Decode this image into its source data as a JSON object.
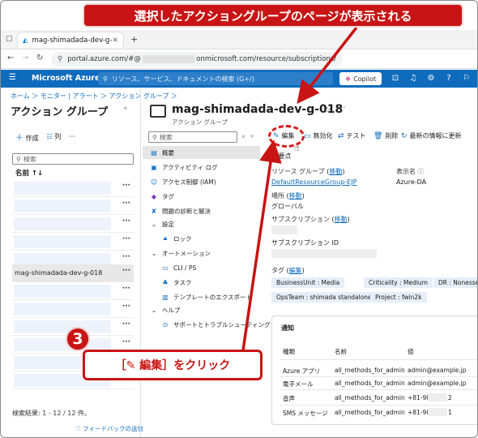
{
  "annotations": {
    "top_callout": "選択したアクショングループのページが表示される",
    "step_number": "3",
    "bottom_callout": "［✎ 編集］をクリック"
  },
  "browser": {
    "tab_title": "mag-shimadada-dev-g-018 - M",
    "url_prefix": "portal.azure.com/#@",
    "url_suffix": "onmicrosoft.com/resource/subscriptions/"
  },
  "portal": {
    "brand": "Microsoft Azure",
    "search_placeholder": "リソース、サービス、ドキュメントの検索 (G+/)",
    "copilot_label": "Copilot"
  },
  "left_pane": {
    "breadcrumb": "ホーム ＞ モニター | アラート ＞ アクション グループ ＞",
    "title": "アクション グループ",
    "create_label": "作成",
    "columns_label": "列",
    "search_placeholder": "検索",
    "name_header": "名前 ↑↓",
    "selected_item": "mag-shimadada-dev-g-018",
    "result_count": "検索結果: 1 - 12 / 12 件。",
    "feedback": "フィードバックの送信"
  },
  "resource": {
    "title": "mag-shimadada-dev-g-018",
    "subtitle": "アクション グループ",
    "menu_search_placeholder": "検索",
    "menu": [
      {
        "label": "概要",
        "icon": "overview-icon"
      },
      {
        "label": "アクティビティ ログ",
        "icon": "activity-log-icon"
      },
      {
        "label": "アクセス制御 (IAM)",
        "icon": "iam-icon"
      },
      {
        "label": "タグ",
        "icon": "tag-icon"
      },
      {
        "label": "問題の診断と解決",
        "icon": "diagnose-icon"
      },
      {
        "label": "設定",
        "icon": "chevron-down-icon"
      },
      {
        "label": "ロック",
        "icon": "lock-icon"
      },
      {
        "label": "オートメーション",
        "icon": "chevron-down-icon"
      },
      {
        "label": "CLI / PS",
        "icon": "cli-icon"
      },
      {
        "label": "タスク",
        "icon": "task-icon"
      },
      {
        "label": "テンプレートのエクスポート",
        "icon": "export-template-icon"
      },
      {
        "label": "ヘルプ",
        "icon": "chevron-down-icon"
      },
      {
        "label": "サポートとトラブルシューティング",
        "icon": "support-icon"
      }
    ],
    "commands": {
      "edit": "編集",
      "disable": "無効化",
      "test": "テスト",
      "delete": "削除",
      "refresh": "最新の情報に更新"
    },
    "essentials": {
      "header": "要点",
      "rg_label": "リソース グループ",
      "move_link": "移動",
      "rg_value": "DefaultResourceGroup-EJP",
      "location_label": "場所",
      "location_value": "グローバル",
      "subscription_label": "サブスクリプション",
      "subscription_id_label": "サブスクリプション ID",
      "short_name_label": "表示名",
      "short_name_value": "Azure-DA",
      "tags_label": "タグ",
      "edit_link": "編集",
      "tags": [
        "BusinessUnit : Media",
        "Criticality : Medium",
        "DR : Nonessential",
        "OpsTeam : shimada standalone",
        "Project : fwin2k"
      ]
    },
    "notifications": {
      "title": "通知",
      "headers": [
        "種類",
        "名前",
        "値"
      ],
      "rows": [
        [
          "Azure アプリ",
          "all_methods_for_admin",
          "admin@example.jp"
        ],
        [
          "電子メール",
          "all_methods_for_admin",
          "admin@example.jp"
        ],
        [
          "音声",
          "all_methods_for_admin",
          "+81-90",
          "2"
        ],
        [
          "SMS メッセージ",
          "all_methods_for_admin",
          "+81-90",
          "1"
        ]
      ]
    }
  }
}
